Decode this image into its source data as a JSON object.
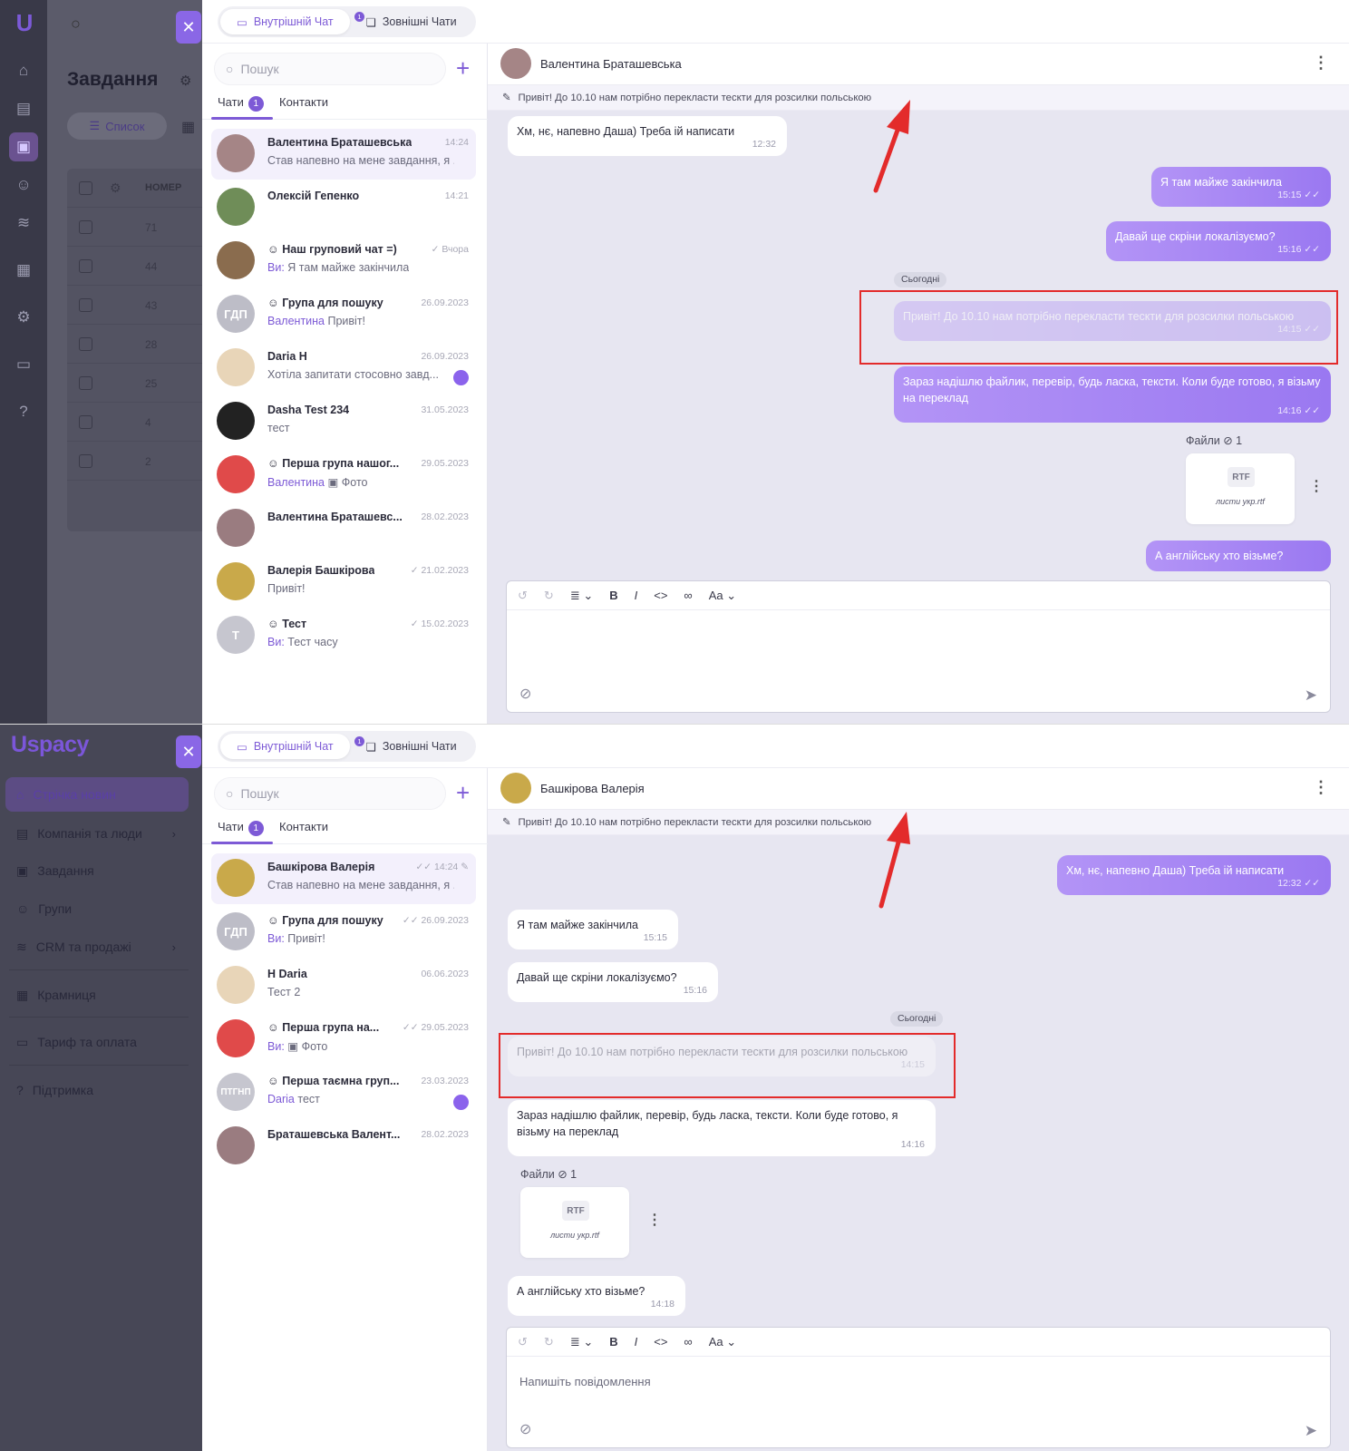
{
  "colors": {
    "accent": "#7d5ad6",
    "annotation_red": "#e32b2b"
  },
  "top": {
    "tasks": {
      "title": "Завдання",
      "list_label": "Список",
      "col_number": "НОМЕР",
      "rows": [
        "71",
        "44",
        "43",
        "28",
        "25",
        "4",
        "2"
      ]
    },
    "tabs": {
      "internal": "Внутрішній Чат",
      "internal_badge": "1",
      "external": "Зовнішні Чати"
    },
    "search_placeholder": "Пошук",
    "chat_tabs": {
      "chats": "Чати",
      "chats_badge": "1",
      "contacts": "Контакти"
    },
    "chats": [
      {
        "name": "Валентина Браташевська",
        "time": "14:24",
        "who": "",
        "preview": "Став напевно на мене завдання, я ..."
      },
      {
        "name": "Олексій Гепенко",
        "time": "14:21",
        "who": "",
        "preview": ""
      },
      {
        "name": "Наш груповий чат =)",
        "time": "Вчора",
        "who": "Ви:",
        "preview": "Я там майже закінчила"
      },
      {
        "name": "Група для пошуку",
        "time": "26.09.2023",
        "who": "Валентина",
        "preview": "Привіт!",
        "initials": "ГДП"
      },
      {
        "name": "Daria H",
        "time": "26.09.2023",
        "who": "",
        "preview": "Хотіла запитати стосовно завд..."
      },
      {
        "name": "Dasha Test 234",
        "time": "31.05.2023",
        "who": "",
        "preview": "тест"
      },
      {
        "name": "Перша група нашог...",
        "time": "29.05.2023",
        "who": "Валентина",
        "preview": "Фото"
      },
      {
        "name": "Валентина Браташевс...",
        "time": "28.02.2023",
        "who": "",
        "preview": ""
      },
      {
        "name": "Валерія Башкірова",
        "time": "21.02.2023",
        "who": "",
        "preview": "Привіт!"
      },
      {
        "name": "Тест",
        "time": "15.02.2023",
        "who": "Ви:",
        "preview": "Тест часу",
        "initials": "Т"
      }
    ],
    "header_name": "Валентина Браташевська",
    "pinned": "Привіт! До 10.10 нам потрібно перекласти тескти для розсилки польською",
    "messages": [
      {
        "text": "Хм, нє, напевно Даша) Треба ій написати",
        "time": "12:32"
      },
      {
        "text": "Я там майже закінчила",
        "time": "15:15"
      },
      {
        "text": "Давай ще скріни локалізуємо?",
        "time": "15:16"
      },
      {
        "text": "Привіт! До 10.10 нам потрібно перекласти тескти для розсилки польською",
        "time": "14:15"
      },
      {
        "text": "Зараз надішлю файлик, перевір, будь ласка, тексти. Коли буде готово, я візьму на переклад",
        "time": "14:16"
      },
      {
        "text": "А англійську хто візьме?",
        "time": ""
      }
    ],
    "day_label": "Сьогодні",
    "files_label": "Файли",
    "files_count": "1",
    "file_type": "RTF",
    "file_name": "листи укр.rtf"
  },
  "bottom": {
    "logo": "spacy",
    "sidebar": [
      "Стрічка новин",
      "Компанія та люди",
      "Завдання",
      "Групи",
      "CRM та продажі",
      "Крамниця",
      "Тариф та оплата",
      "Підтримка"
    ],
    "tabs": {
      "internal": "Внутрішній Чат",
      "internal_badge": "1",
      "external": "Зовнішні Чати"
    },
    "search_placeholder": "Пошук",
    "chat_tabs": {
      "chats": "Чати",
      "chats_badge": "1",
      "contacts": "Контакти"
    },
    "chats": [
      {
        "name": "Башкірова Валерія",
        "time": "14:24",
        "who": "",
        "preview": "Став напевно на мене завдання, я ..."
      },
      {
        "name": "Група для пошуку",
        "time": "26.09.2023",
        "who": "Ви:",
        "preview": "Привіт!",
        "initials": "ГДП"
      },
      {
        "name": "H Daria",
        "time": "06.06.2023",
        "who": "",
        "preview": "Тест 2"
      },
      {
        "name": "Перша група на...",
        "time": "29.05.2023",
        "who": "Ви:",
        "preview": "Фото"
      },
      {
        "name": "Перша таємна груп...",
        "time": "23.03.2023",
        "who": "Daria",
        "preview": "тест",
        "initials": "ПТГНП"
      },
      {
        "name": "Браташевська Валент...",
        "time": "28.02.2023",
        "who": "",
        "preview": ""
      }
    ],
    "header_name": "Башкірова Валерія",
    "pinned": "Привіт! До 10.10 нам потрібно перекласти тескти для розсилки польською",
    "messages": [
      {
        "text": "Хм, нє, напевно Даша) Треба ій написати",
        "time": "12:32"
      },
      {
        "text": "Я там майже закінчила",
        "time": "15:15"
      },
      {
        "text": "Давай ще скріни локалізуємо?",
        "time": "15:16"
      },
      {
        "text": "Привіт! До 10.10 нам потрібно перекласти тескти для розсилки польською",
        "time": "14:15"
      },
      {
        "text": "Зараз надішлю файлик, перевір, будь ласка, тексти. Коли буде готово, я візьму на переклад",
        "time": "14:16"
      },
      {
        "text": "А англійську хто візьме?",
        "time": "14:18"
      }
    ],
    "day_label": "Сьогодні",
    "files_label": "Файли",
    "files_count": "1",
    "file_type": "RTF",
    "file_name": "листи укр.rtf",
    "composer_placeholder": "Напишіть повідомлення"
  }
}
